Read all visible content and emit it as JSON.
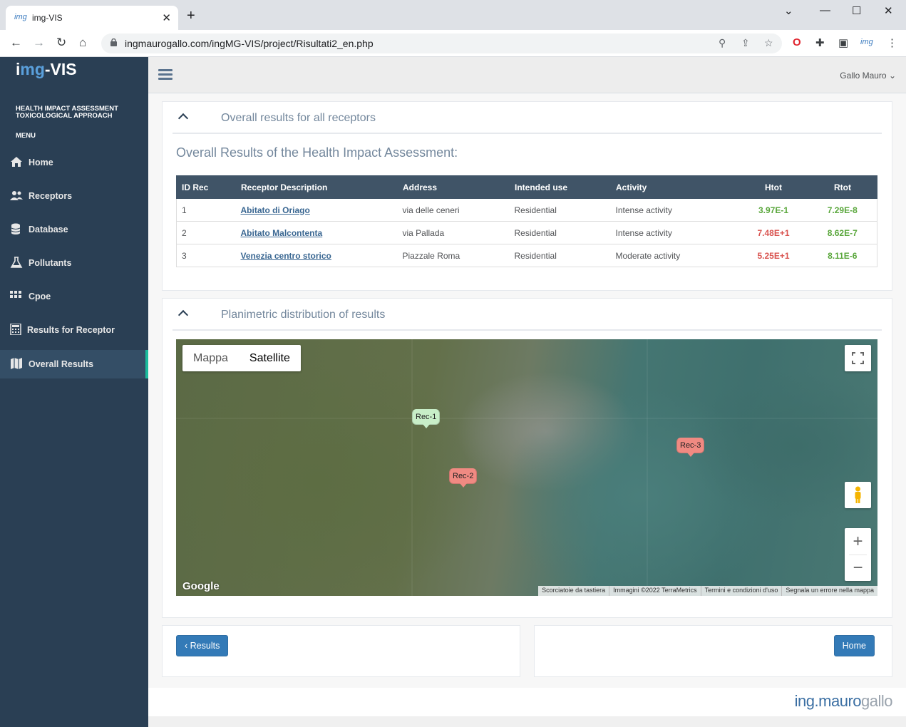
{
  "browser": {
    "tab_favicon": "img",
    "tab_title": "img-VIS",
    "url": "ingmaurogallo.com/ingMG-VIS/project/Risultati2_en.php",
    "profile_badge": "img"
  },
  "sidebar": {
    "logo_prefix": "i",
    "logo_mg": "mg",
    "logo_suffix": "-VIS",
    "subtitle_line1": "HEALTH IMPACT ASSESSMENT",
    "subtitle_line2": "TOXICOLOGICAL APPROACH",
    "menu_label": "MENU",
    "items": [
      {
        "label": "Home",
        "icon": "home-icon"
      },
      {
        "label": "Receptors",
        "icon": "users-icon"
      },
      {
        "label": "Database",
        "icon": "database-icon"
      },
      {
        "label": "Pollutants",
        "icon": "flask-icon"
      },
      {
        "label": "Cpoe",
        "icon": "grid-icon"
      },
      {
        "label": "Results for Receptor",
        "icon": "calculator-icon"
      },
      {
        "label": "Overall Results",
        "icon": "map-icon"
      }
    ]
  },
  "topnav": {
    "user": "Gallo Mauro"
  },
  "panel_results": {
    "header": "Overall results for all receptors",
    "title": "Overall Results of the Health Impact Assessment:",
    "columns": [
      "ID Rec",
      "Receptor Description",
      "Address",
      "Intended use",
      "Activity",
      "Htot",
      "Rtot"
    ],
    "rows": [
      {
        "id": "1",
        "desc": "Abitato di Oriago",
        "address": "via delle ceneri",
        "use": "Residential",
        "activity": "Intense activity",
        "htot": "3.97E-1",
        "rtot": "7.29E-8"
      },
      {
        "id": "2",
        "desc": "Abitato Malcontenta",
        "address": "via Pallada",
        "use": "Residential",
        "activity": "Intense activity",
        "htot": "7.48E+1",
        "rtot": "8.62E-7"
      },
      {
        "id": "3",
        "desc": "Venezia centro storico",
        "address": "Piazzale Roma",
        "use": "Residential",
        "activity": "Moderate activity",
        "htot": "5.25E+1",
        "rtot": "8.11E-6"
      }
    ]
  },
  "panel_map": {
    "header": "Planimetric distribution of results",
    "map_type_map": "Mappa",
    "map_type_satellite": "Satellite",
    "markers": [
      "Rec-1",
      "Rec-2",
      "Rec-3"
    ],
    "google": "Google",
    "attribution": [
      "Scorciatoie da tastiera",
      "Immagini ©2022 TerraMetrics",
      "Termini e condizioni d'uso",
      "Segnala un errore nella mappa"
    ]
  },
  "buttons": {
    "results": "Results",
    "home": "Home"
  },
  "footer": {
    "brand_ing": "ing.mauro",
    "brand_gallo": "gallo"
  }
}
